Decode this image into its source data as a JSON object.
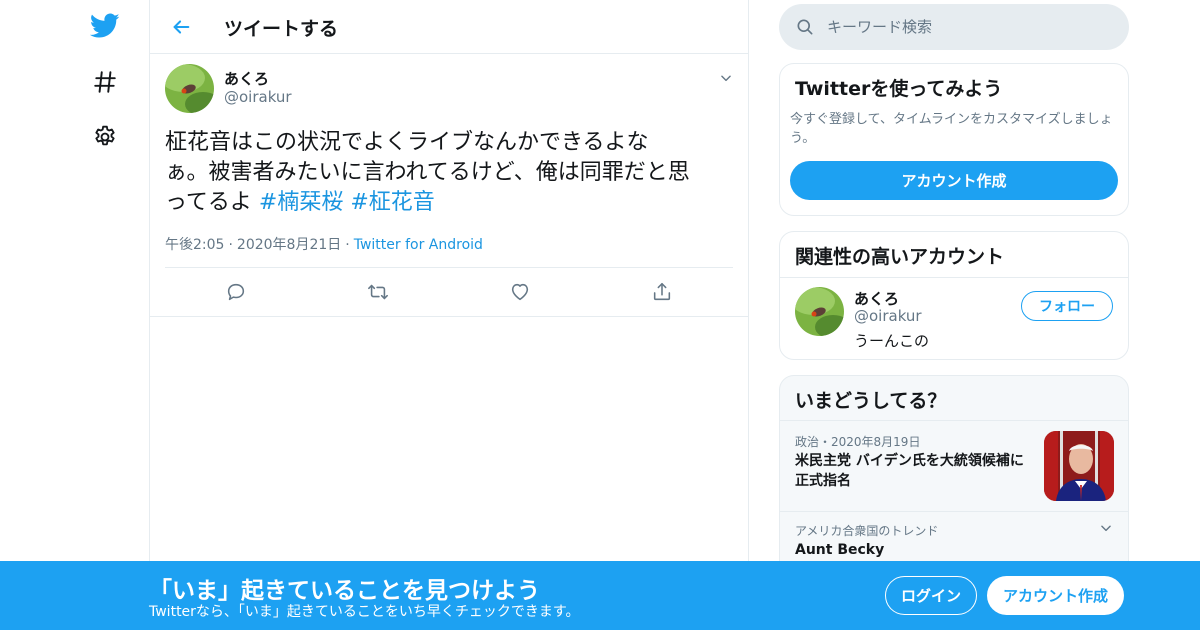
{
  "colors": {
    "accent": "#1da1f2",
    "link": "#1b95e0",
    "text_primary": "#14171a",
    "text_secondary": "#657786",
    "border": "#e6ecf0"
  },
  "nav": {
    "items": [
      {
        "name": "twitter-logo-icon",
        "icon": "twitter-bird"
      },
      {
        "name": "explore-hashtag-icon",
        "icon": "hashtag"
      },
      {
        "name": "settings-gear-icon",
        "icon": "gear"
      }
    ]
  },
  "header": {
    "back_icon": "arrow-left",
    "title": "ツイートする"
  },
  "tweet": {
    "author_name": "あくろ",
    "author_handle": "@oirakur",
    "text_lines": [
      "柾花音はこの状況でよくライブなんかできるよな",
      "ぁ。被害者みたいに言われてるけど、俺は同罪だと思",
      "ってるよ"
    ],
    "hashtags": [
      "#楠栞桜",
      "#柾花音"
    ],
    "time": "午後2:05",
    "date": "2020年8月21日",
    "source": "Twitter for Android",
    "actions": [
      {
        "name": "reply-icon",
        "icon": "reply"
      },
      {
        "name": "retweet-icon",
        "icon": "retweet"
      },
      {
        "name": "like-icon",
        "icon": "heart"
      },
      {
        "name": "share-icon",
        "icon": "share"
      }
    ]
  },
  "search": {
    "placeholder": "キーワード検索",
    "value": ""
  },
  "signup_card": {
    "title": "Twitterを使ってみよう",
    "description": "今すぐ登録して、タイムラインをカスタマイズしましょう。",
    "button_label": "アカウント作成"
  },
  "related_card": {
    "title": "関連性の高いアカウント",
    "account": {
      "name": "あくろ",
      "handle": "@oirakur",
      "bio": "うーんこの",
      "follow_label": "フォロー"
    }
  },
  "trends_card": {
    "title": "いまどうしてる？",
    "items": [
      {
        "meta": "政治・2020年8月19日",
        "headline": "米民主党 バイデン氏を大統領候補に正式指名"
      },
      {
        "meta": "アメリカ合衆国のトレンド",
        "name": "Aunt Becky"
      }
    ]
  },
  "banner": {
    "title": "「いま」起きていることを見つけよう",
    "subtitle": "Twitterなら、「いま」起きていることをいち早くチェックできます。",
    "login_label": "ログイン",
    "signup_label": "アカウント作成"
  }
}
